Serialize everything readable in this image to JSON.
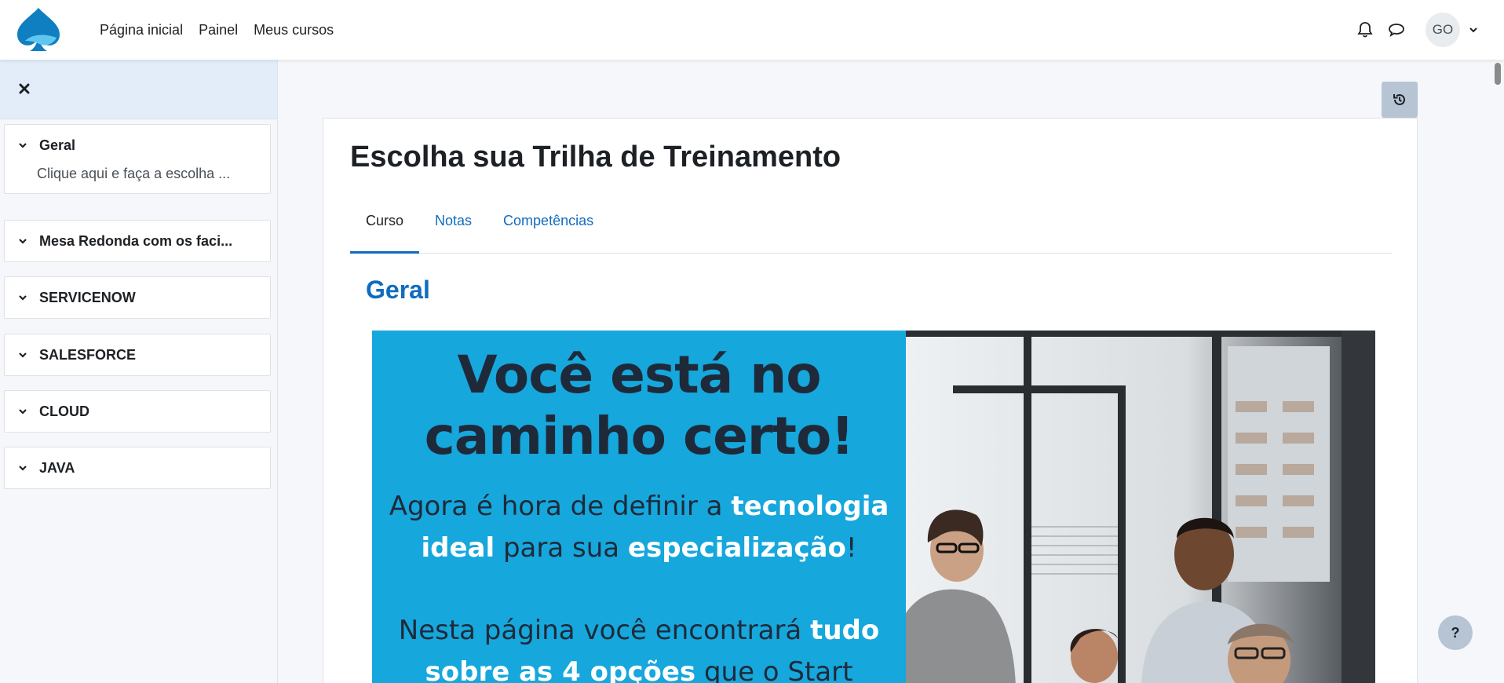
{
  "navbar": {
    "links": [
      "Página inicial",
      "Painel",
      "Meus cursos"
    ],
    "avatar_initials": "GO",
    "icons": [
      "notification-bell-icon",
      "messages-icon",
      "chevron-down-icon"
    ]
  },
  "drawer": {
    "close_icon": "close-icon",
    "sections": [
      {
        "title": "Geral",
        "items": [
          "Clique aqui e faça a escolha ..."
        ]
      },
      {
        "title": "Mesa Redonda com os faci..."
      },
      {
        "title": "SERVICENOW"
      },
      {
        "title": "SALESFORCE"
      },
      {
        "title": "CLOUD"
      },
      {
        "title": "JAVA"
      }
    ]
  },
  "main": {
    "title": "Escolha sua Trilha de Treinamento",
    "tabs": [
      {
        "label": "Curso",
        "active": true
      },
      {
        "label": "Notas",
        "active": false
      },
      {
        "label": "Competências",
        "active": false
      }
    ],
    "section_heading": "Geral",
    "banner": {
      "headline_line1": "Você está no",
      "headline_line2": "caminho certo!",
      "p1_a": "Agora é hora de definir a ",
      "p1_b": "tecnologia",
      "p1_c": "ideal",
      "p1_d": " para sua ",
      "p1_e": "especialização",
      "p1_f": "!",
      "p2_a": "Nesta página você encontrará ",
      "p2_b": "tudo",
      "p2_c": "sobre as 4 opções",
      "p2_d": " que o Start"
    }
  },
  "help_label": "?",
  "colors": {
    "accent": "#0f6cbf",
    "banner_blue": "#16a7dc",
    "drawer_head": "#e3edf9"
  }
}
